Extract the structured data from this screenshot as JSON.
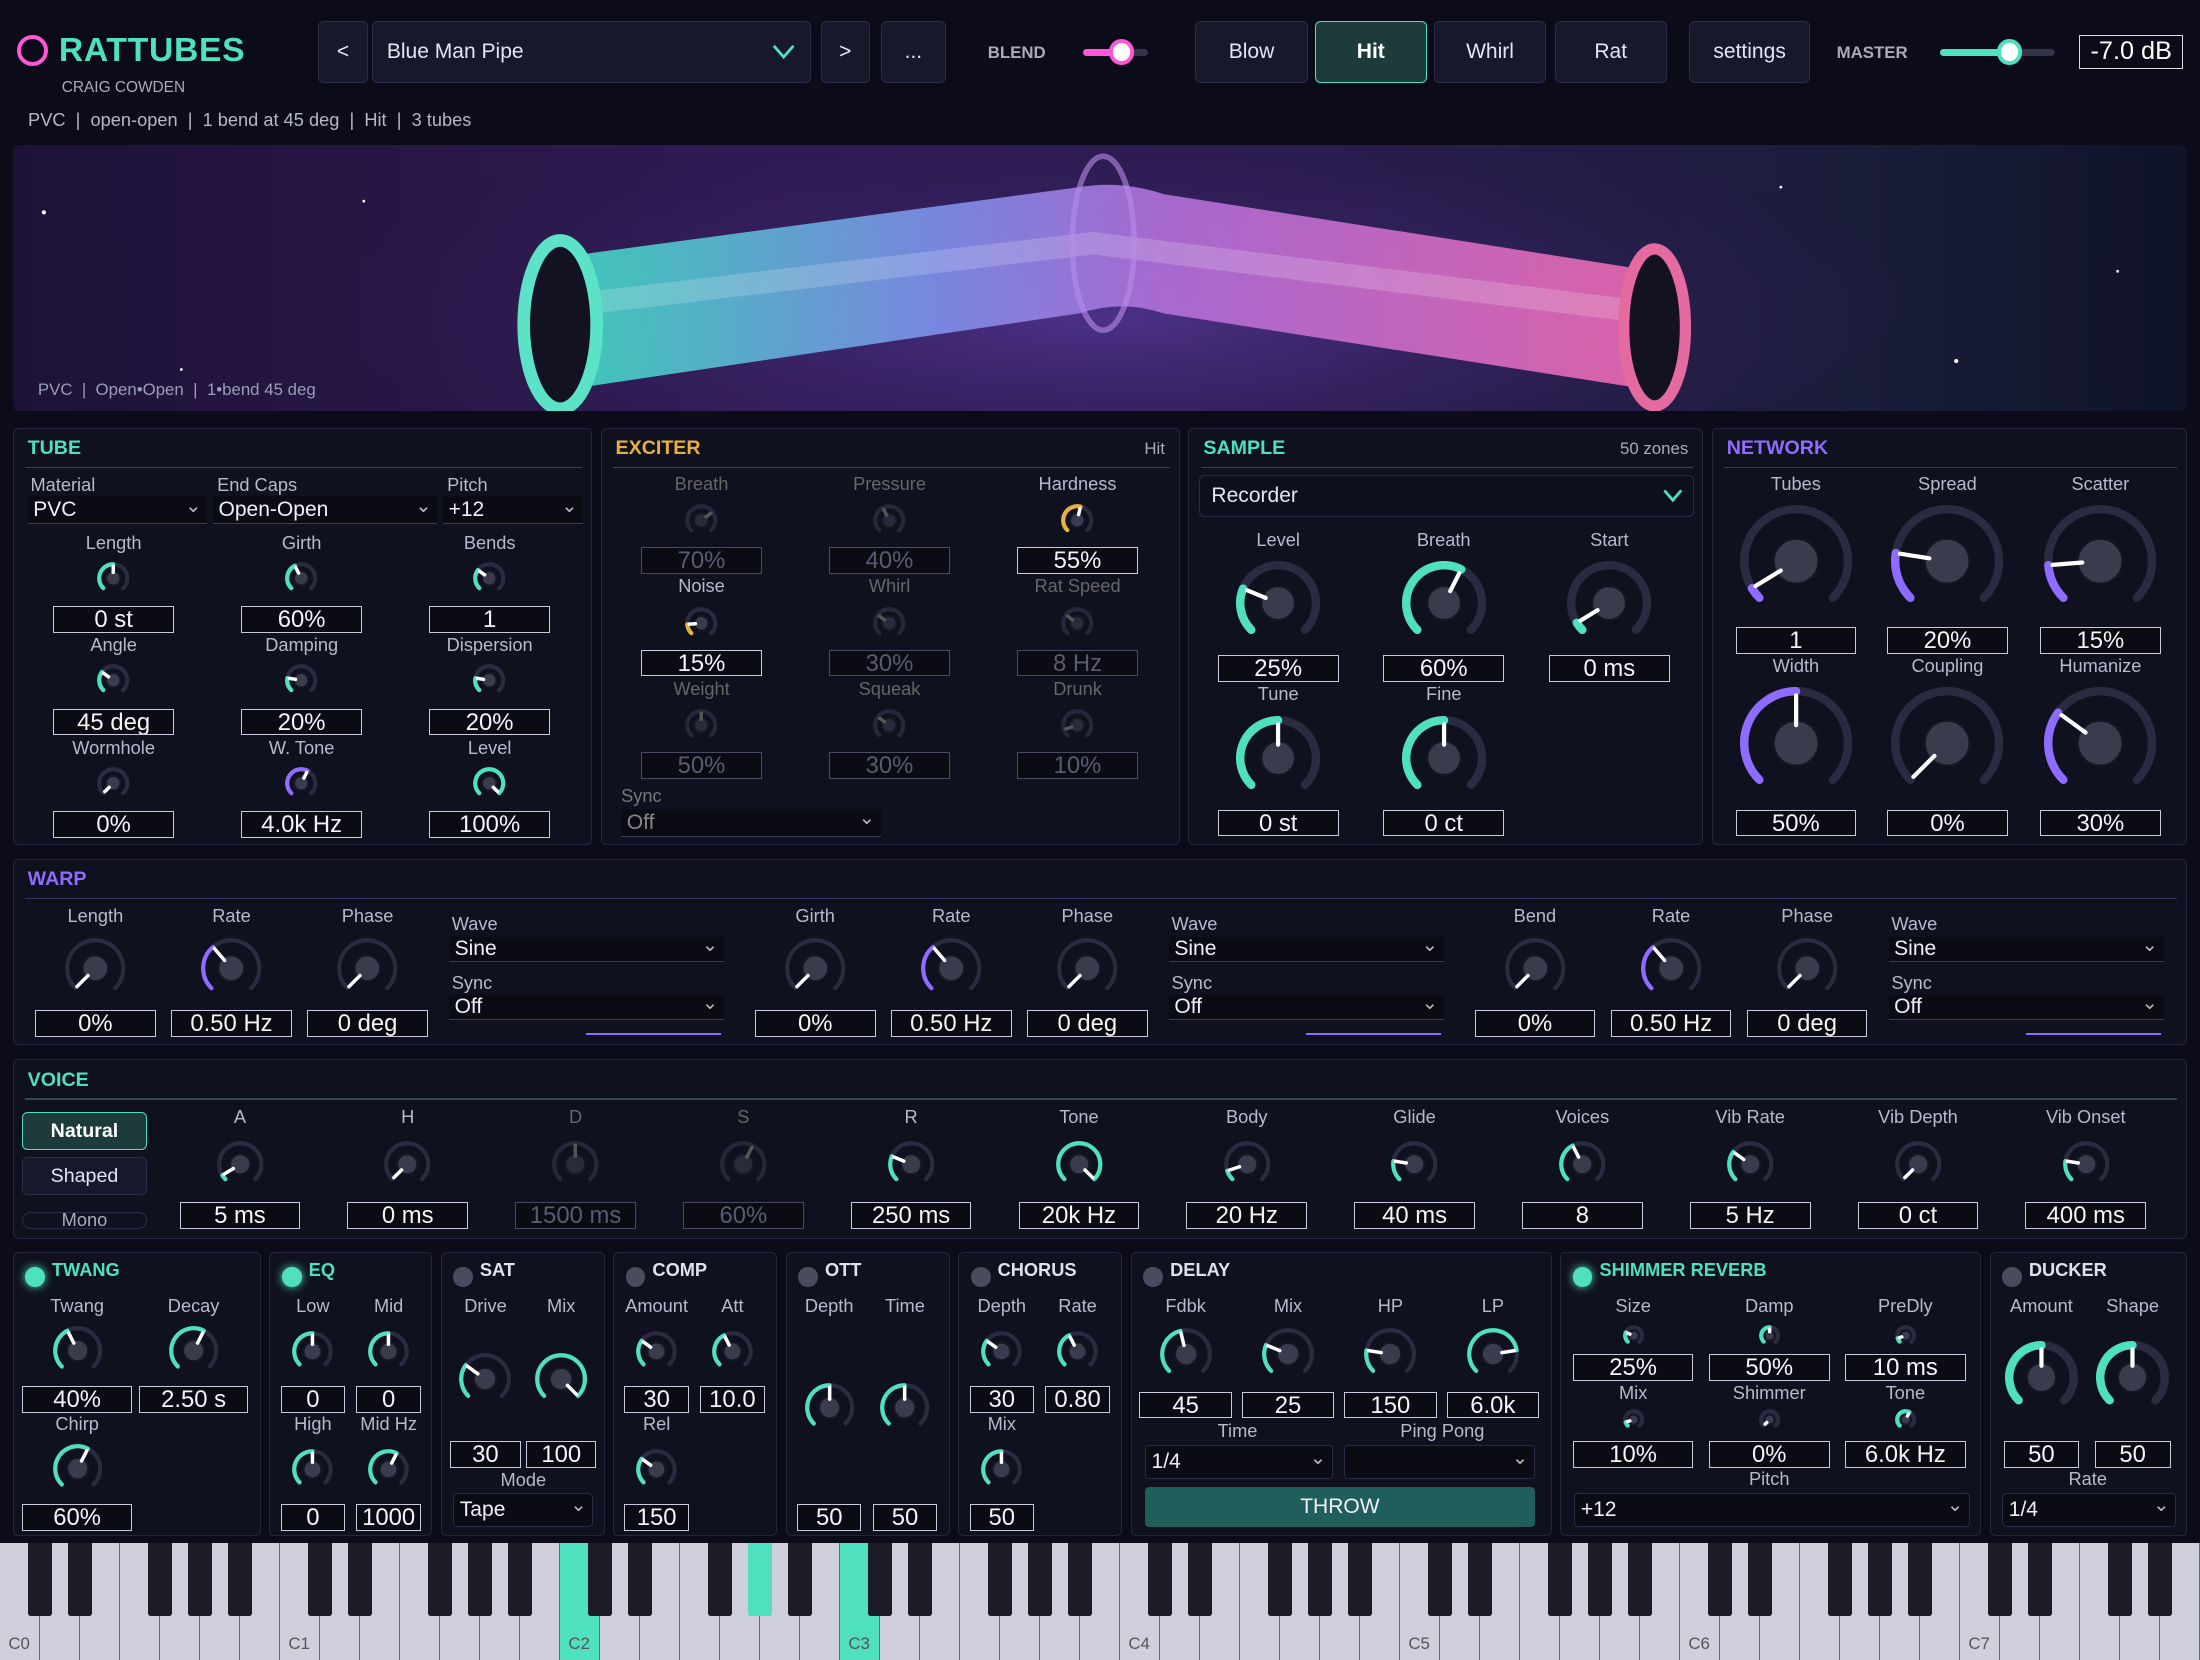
{
  "colors": {
    "accent": "#4ee0bf",
    "purple": "#8e6cff",
    "gold": "#e8b03c",
    "pink": "#ff56d6"
  },
  "header": {
    "brand": "RATTUBES",
    "author": "CRAIG COWDEN",
    "preset": "Blue Man Pipe",
    "prev": "<",
    "next": ">",
    "more": "...",
    "blend_label": "BLEND",
    "blend_level": 0.6,
    "modes": [
      "Blow",
      "Hit",
      "Whirl",
      "Rat"
    ],
    "active_mode": "Hit",
    "settings": "settings",
    "master_label": "MASTER",
    "master_value": "-7.0 dB",
    "master_level": 0.6
  },
  "info_line": "PVC  |  open-open  |  1 bend at 45 deg  |  Hit  |  3 tubes",
  "visual_caption": "PVC  |  Open•Open  |  1•bend 45 deg",
  "tube": {
    "title": "TUBE",
    "material_label": "Material",
    "material": "PVC",
    "endcaps_label": "End Caps",
    "endcaps": "Open-Open",
    "pitch_label": "Pitch",
    "pitch": "+12",
    "knobs": [
      {
        "label": "Length",
        "value": "0 st"
      },
      {
        "label": "Girth",
        "value": "60%"
      },
      {
        "label": "Bends",
        "value": "1"
      },
      {
        "label": "Angle",
        "value": "45 deg"
      },
      {
        "label": "Damping",
        "value": "20%"
      },
      {
        "label": "Dispersion",
        "value": "20%"
      },
      {
        "label": "Wormhole",
        "value": "0%"
      },
      {
        "label": "W. Tone",
        "value": "4.0k Hz"
      },
      {
        "label": "Level",
        "value": "100%"
      }
    ]
  },
  "exciter": {
    "title": "EXCITER",
    "tag": "Hit",
    "sync_label": "Sync",
    "sync": "Off",
    "knobs": [
      {
        "label": "Breath",
        "value": "70%"
      },
      {
        "label": "Pressure",
        "value": "40%"
      },
      {
        "label": "Hardness",
        "value": "55%"
      },
      {
        "label": "Noise",
        "value": "15%"
      },
      {
        "label": "Whirl",
        "value": "30%"
      },
      {
        "label": "Rat Speed",
        "value": "8 Hz"
      },
      {
        "label": "Weight",
        "value": "50%"
      },
      {
        "label": "Squeak",
        "value": "30%"
      },
      {
        "label": "Drunk",
        "value": "10%"
      }
    ]
  },
  "sample": {
    "title": "SAMPLE",
    "zones": "50 zones",
    "source": "Recorder",
    "knobs": [
      {
        "label": "Level",
        "value": "25%"
      },
      {
        "label": "Breath",
        "value": "60%"
      },
      {
        "label": "Start",
        "value": "0 ms"
      },
      {
        "label": "Tune",
        "value": "0 st"
      },
      {
        "label": "Fine",
        "value": "0 ct"
      }
    ]
  },
  "network": {
    "title": "NETWORK",
    "knobs": [
      {
        "label": "Tubes",
        "value": "1"
      },
      {
        "label": "Spread",
        "value": "20%"
      },
      {
        "label": "Scatter",
        "value": "15%"
      },
      {
        "label": "Width",
        "value": "50%"
      },
      {
        "label": "Coupling",
        "value": "0%"
      },
      {
        "label": "Humanize",
        "value": "30%"
      }
    ]
  },
  "warp": {
    "title": "WARP",
    "wave_label": "Wave",
    "sync_label": "Sync",
    "groups": [
      {
        "knobs": [
          {
            "label": "Length",
            "value": "0%"
          },
          {
            "label": "Rate",
            "value": "0.50 Hz"
          },
          {
            "label": "Phase",
            "value": "0 deg"
          }
        ],
        "wave": "Sine",
        "sync": "Off"
      },
      {
        "knobs": [
          {
            "label": "Girth",
            "value": "0%"
          },
          {
            "label": "Rate",
            "value": "0.50 Hz"
          },
          {
            "label": "Phase",
            "value": "0 deg"
          }
        ],
        "wave": "Sine",
        "sync": "Off"
      },
      {
        "knobs": [
          {
            "label": "Bend",
            "value": "0%"
          },
          {
            "label": "Rate",
            "value": "0.50 Hz"
          },
          {
            "label": "Phase",
            "value": "0 deg"
          }
        ],
        "wave": "Sine",
        "sync": "Off"
      }
    ]
  },
  "voice": {
    "title": "VOICE",
    "modes": [
      "Natural",
      "Shaped",
      "Mono"
    ],
    "knobs": [
      {
        "label": "A",
        "value": "5 ms"
      },
      {
        "label": "H",
        "value": "0 ms"
      },
      {
        "label": "D",
        "value": "1500 ms"
      },
      {
        "label": "S",
        "value": "60%"
      },
      {
        "label": "R",
        "value": "250 ms"
      },
      {
        "label": "Tone",
        "value": "20k Hz"
      },
      {
        "label": "Body",
        "value": "20 Hz"
      },
      {
        "label": "Glide",
        "value": "40 ms"
      },
      {
        "label": "Voices",
        "value": "8"
      },
      {
        "label": "Vib Rate",
        "value": "5 Hz"
      },
      {
        "label": "Vib Depth",
        "value": "0 ct"
      },
      {
        "label": "Vib Onset",
        "value": "400 ms"
      }
    ]
  },
  "fx": {
    "twang": {
      "title": "TWANG",
      "knobs": [
        {
          "label": "Twang",
          "value": "40%"
        },
        {
          "label": "Decay",
          "value": "2.50 s"
        },
        {
          "label": "Chirp",
          "value": "60%"
        }
      ]
    },
    "eq": {
      "title": "EQ",
      "knobs": [
        {
          "label": "Low",
          "value": "0"
        },
        {
          "label": "Mid",
          "value": "0"
        },
        {
          "label": "High",
          "value": "0"
        },
        {
          "label": "Mid Hz",
          "value": "1000"
        }
      ]
    },
    "sat": {
      "title": "SAT",
      "mode_label": "Mode",
      "mode": "Tape",
      "knobs": [
        {
          "label": "Drive",
          "value": "30"
        },
        {
          "label": "Mix",
          "value": "100"
        }
      ]
    },
    "comp": {
      "title": "COMP",
      "knobs": [
        {
          "label": "Amount",
          "value": "30"
        },
        {
          "label": "Att",
          "value": "10.0"
        },
        {
          "label": "Rel",
          "value": "150"
        }
      ]
    },
    "ott": {
      "title": "OTT",
      "knobs": [
        {
          "label": "Depth",
          "value": "50"
        },
        {
          "label": "Time",
          "value": "50"
        }
      ]
    },
    "chorus": {
      "title": "CHORUS",
      "knobs": [
        {
          "label": "Depth",
          "value": "30"
        },
        {
          "label": "Rate",
          "value": "0.80"
        },
        {
          "label": "Mix",
          "value": "50"
        }
      ]
    },
    "delay": {
      "title": "DELAY",
      "time_label": "Time",
      "time": "1/4",
      "pingpong_label": "Ping Pong",
      "throw": "THROW",
      "knobs": [
        {
          "label": "Fdbk",
          "value": "45"
        },
        {
          "label": "Mix",
          "value": "25"
        },
        {
          "label": "HP",
          "value": "150"
        },
        {
          "label": "LP",
          "value": "6.0k"
        }
      ]
    },
    "reverb": {
      "title": "SHIMMER REVERB",
      "pitch_label": "Pitch",
      "pitch": "+12",
      "knobs": [
        {
          "label": "Size",
          "value": "25%"
        },
        {
          "label": "Damp",
          "value": "50%"
        },
        {
          "label": "PreDly",
          "value": "10 ms"
        },
        {
          "label": "Mix",
          "value": "10%"
        },
        {
          "label": "Shimmer",
          "value": "0%"
        },
        {
          "label": "Tone",
          "value": "6.0k Hz"
        }
      ]
    },
    "ducker": {
      "title": "DUCKER",
      "rate_label": "Rate",
      "rate": "1/4",
      "knobs": [
        {
          "label": "Amount",
          "value": "50"
        },
        {
          "label": "Shape",
          "value": "50"
        }
      ]
    }
  },
  "keyboard": {
    "octaves": [
      "C0",
      "C1",
      "C2",
      "C3",
      "C4",
      "C5",
      "C6",
      "C7"
    ]
  }
}
